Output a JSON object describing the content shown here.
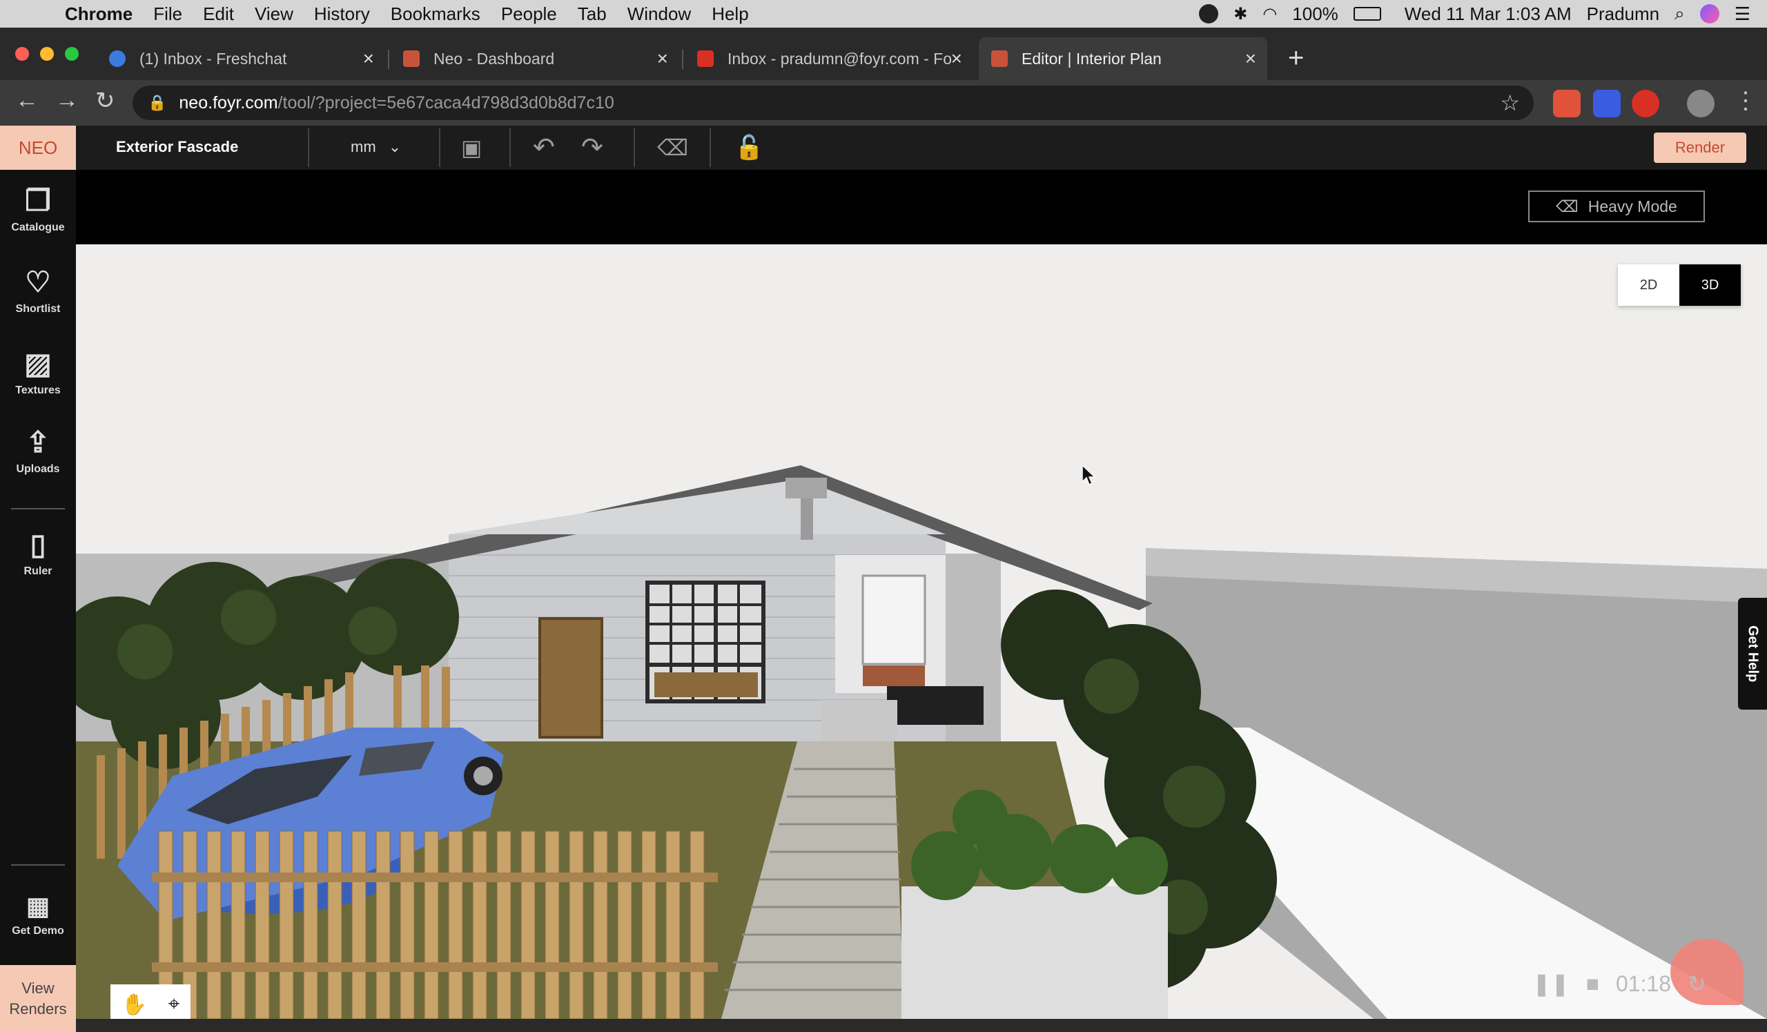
{
  "menubar": {
    "app": "Chrome",
    "items": [
      "File",
      "Edit",
      "View",
      "History",
      "Bookmarks",
      "People",
      "Tab",
      "Window",
      "Help"
    ],
    "battery": "100%",
    "clock": "Wed 11 Mar  1:03 AM",
    "user": "Pradumn"
  },
  "tabs": [
    {
      "title": "(1) Inbox - Freshchat",
      "favicon_color": "#3b7be0"
    },
    {
      "title": "Neo - Dashboard",
      "favicon_color": "#c8533a"
    },
    {
      "title": "Inbox - pradumn@foyr.com - Fo",
      "favicon_color": "#d93025"
    },
    {
      "title": "Editor | Interior Plan",
      "favicon_color": "#c8533a"
    }
  ],
  "address": {
    "host": "neo.foyr.com",
    "path": "/tool/?project=5e67caca4d798d3d0b8d7c10"
  },
  "toolbar": {
    "logo": "NEO",
    "project_name": "Exterior Fascade",
    "unit": "mm",
    "render_label": "Render",
    "heavy_mode_label": "Heavy Mode"
  },
  "sidebar": {
    "items": [
      {
        "label": "Catalogue",
        "icon": "catalogue-icon"
      },
      {
        "label": "Shortlist",
        "icon": "shortlist-icon"
      },
      {
        "label": "Textures",
        "icon": "textures-icon"
      },
      {
        "label": "Uploads",
        "icon": "upload-icon"
      },
      {
        "label": "Ruler",
        "icon": "ruler-icon"
      },
      {
        "label": "Get Demo",
        "icon": "demo-icon"
      }
    ],
    "view_renders_line1": "View",
    "view_renders_line2": "Renders"
  },
  "view_toggle": {
    "option_2d": "2D",
    "option_3d": "3D",
    "selected": "3D"
  },
  "get_help": "Get Help",
  "recorder": {
    "time": "01:18"
  },
  "colors": {
    "accent": "#f6c9b5",
    "accent_text": "#c24a2e",
    "dark": "#1c1c1c"
  }
}
